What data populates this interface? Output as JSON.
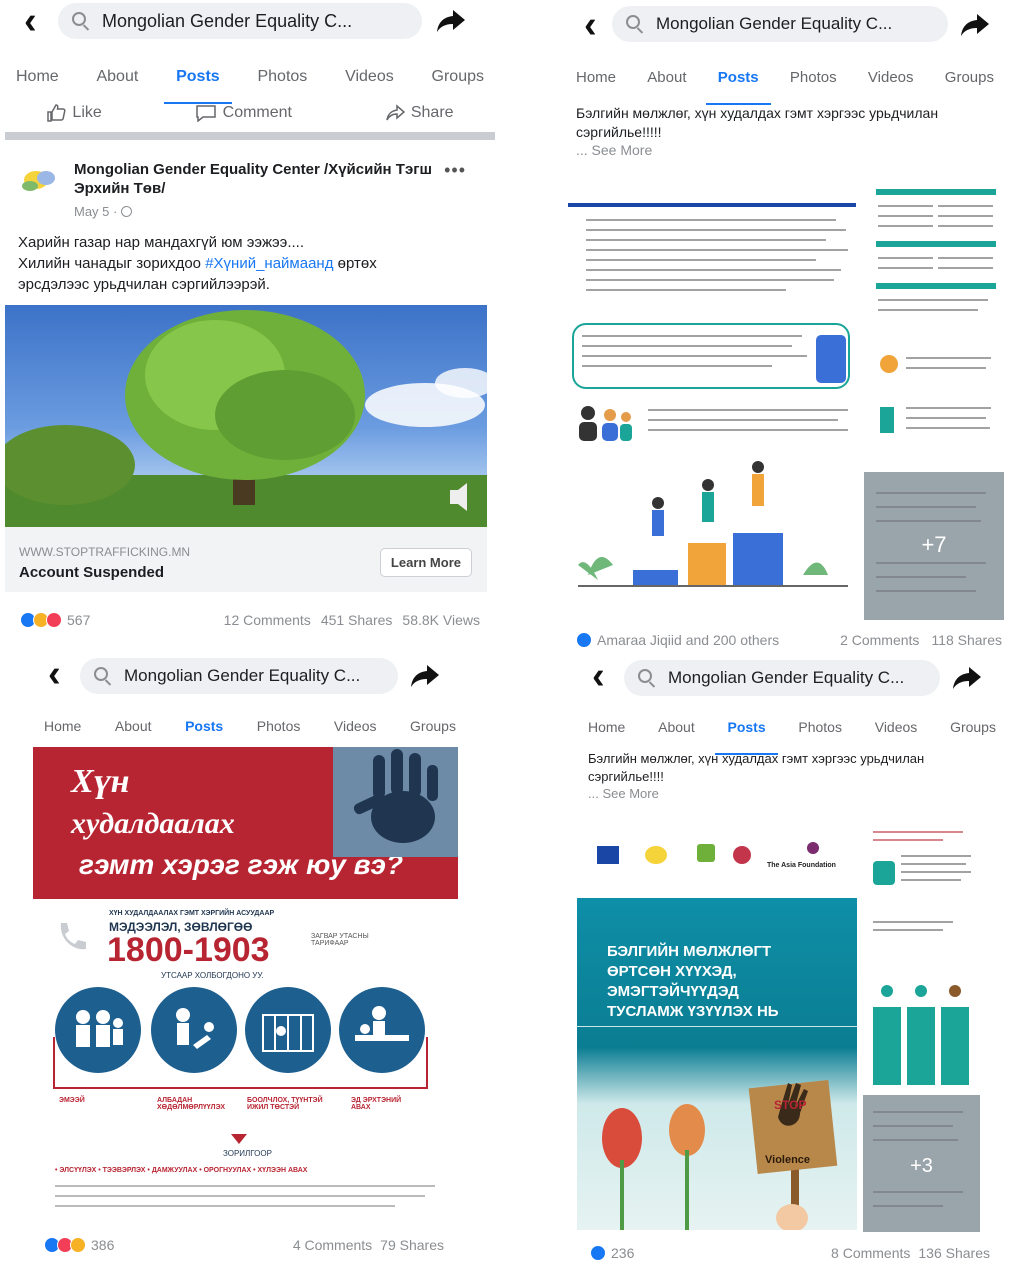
{
  "common": {
    "search_text": "Mongolian Gender Equality C...",
    "tabs": [
      "Home",
      "About",
      "Posts",
      "Photos",
      "Videos",
      "Groups"
    ],
    "accent": "#1877f2"
  },
  "panel1": {
    "actions": {
      "like": "Like",
      "comment": "Comment",
      "share": "Share"
    },
    "page_name": "Mongolian Gender Equality Center /Хүйсийн Тэгш Эрхийн Төв/",
    "date": "May 5 · ",
    "text_line1": "Харийн газар нар мандахгүй юм ээжээ....",
    "text_line2_pre": "Хилийн чанадыг зорихдоо ",
    "hashtag": "#Хүний_наймаанд",
    "text_line2_post": " өртөх",
    "text_line3": "эрсдэлээс урьдчилан сэргийлээрэй.",
    "link_url": "WWW.STOPTRAFFICKING.MN",
    "link_title": "Account Suspended",
    "learn_more": "Learn More",
    "reactions": "567",
    "comments": "12 Comments",
    "shares": "451 Shares",
    "views": "58.8K Views"
  },
  "panel2": {
    "text": "Бэлгийн мөлжлөг, хүн худалдах гэмт хэргээс урьдчилан сэргийлье!!!!!",
    "see_more": "... See More",
    "more_count": "+7",
    "reactions": "Amaraa Jiqiid and 200 others",
    "comments": "2 Comments",
    "shares": "118 Shares"
  },
  "panel3": {
    "poster_line1": "Хүн",
    "poster_line2": "худалдаалах",
    "poster_line3": "гэмт хэрэг гэж юу вэ?",
    "hotline_title": "ХҮН ХУДАЛДААЛАХ ГЭМТ ХЭРГИЙН АСУУДААР",
    "hotline_subtitle": "МЭДЭЭЛЭЛ, ЗӨВЛӨГӨӨ",
    "hotline_number": "1800-1903",
    "hotline_note": "УТСААР ХОЛБОГДОНО УУ.",
    "free_call": "ЗАГВАР УТАСНЫ ТАРИФААР",
    "circle_captions": [
      "ЭМЭЭЙ",
      "АЛБАДАН ХӨДӨЛМӨРЛҮҮЛЭХ",
      "БООЛЧЛОХ, ТҮҮНТЭЙ ИЖИЛ ТӨСТЭЙ",
      "ЭД ЭРХТЭНИЙ АВАХ"
    ],
    "purpose_label": "ЗОРИЛГООР",
    "bottom_line": "• ЭЛСҮҮЛЭХ • ТЭЭВЭРЛЭХ • ДАМЖУУЛАХ • ОРОГНУУЛАХ • ХҮЛЭЭН АВАХ",
    "reactions": "386",
    "comments": "4 Comments",
    "shares": "79 Shares"
  },
  "panel4": {
    "text": "Бэлгийн мөлжлөг, хүн худалдах гэмт хэргээс урьдчилан сэргийлье!!!!",
    "see_more": "... See More",
    "partner": "The Asia Foundation",
    "banner_title": "БЭЛГИЙН МӨЛЖЛӨГТ ӨРТСӨН ХҮҮХЭД, ЭМЭГТЭЙЧҮҮДЭД ТУСЛАМЖ ҮЗҮҮЛЭХ НЬ",
    "sign_top": "STOP",
    "sign_bottom": "Violence",
    "more_count": "+3",
    "reactions": "236",
    "comments": "8 Comments",
    "shares": "136 Shares"
  }
}
